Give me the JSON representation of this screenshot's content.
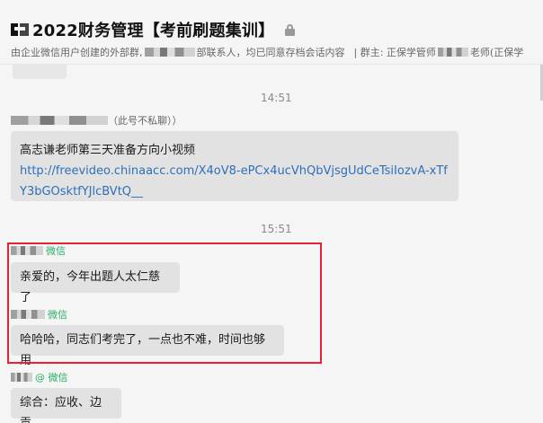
{
  "header": {
    "title": "2022财务管理【考前刷题集训】",
    "subtitle_prefix": "由企业微信用户创建的外部群,",
    "subtitle_suffix": "部联系人，均已同意存档会话内容",
    "group_owner_label": "| 群主: 正保学管师",
    "group_owner_suffix": "老师(正保学"
  },
  "messages": [
    {
      "timestamp": "14:51",
      "sender_note": "（此号不私聊））",
      "text_line1": "高志谦老师第三天准备方向小视频",
      "link": "http://freevideo.chinaacc.com/X4oV8-ePCx4ucVhQbVjsgUdCeTsiIozvA-xTfY3bGOsktfYJlcBVtQ__"
    },
    {
      "timestamp": "15:51",
      "sender_tag": "微信",
      "text": "亲爱的，今年出题人太仁慈了"
    },
    {
      "sender_tag": "微信",
      "text": "哈哈哈，同志们考完了，一点也不难，时间也够用"
    },
    {
      "sender_tag": "@ 微信",
      "text": "综合：应收、边贡"
    }
  ],
  "colors": {
    "highlight_border": "#e8232f",
    "wechat_tag": "#2aae67",
    "link": "#2f6fb8"
  }
}
